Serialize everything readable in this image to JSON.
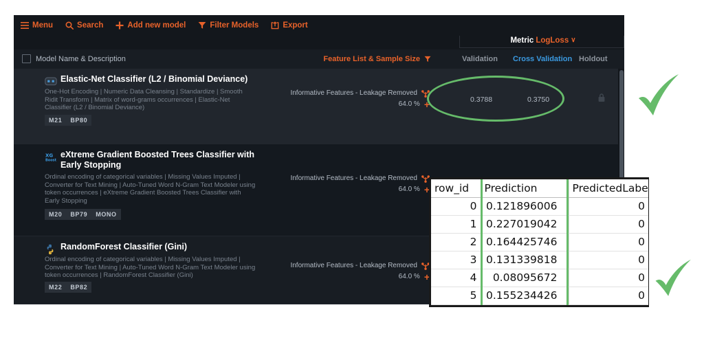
{
  "toolbar": {
    "items": [
      {
        "label": "Menu",
        "icon": "hamburger-icon"
      },
      {
        "label": "Search",
        "icon": "magnifier-icon"
      },
      {
        "label": "Add new model",
        "icon": "plus-icon"
      },
      {
        "label": "Filter Models",
        "icon": "funnel-icon"
      },
      {
        "label": "Export",
        "icon": "export-icon"
      }
    ],
    "metric_label": "Metric",
    "metric_value": "LogLoss",
    "metric_caret": "∨"
  },
  "columns": {
    "model": "Model Name & Description",
    "feature": "Feature List & Sample Size",
    "feature_icon": "funnel-icon",
    "validation": "Validation",
    "cross_validation": "Cross Validation",
    "holdout": "Holdout"
  },
  "rows": [
    {
      "icon": "robot-icon",
      "title": "Elastic-Net Classifier (L2 / Binomial Deviance)",
      "description": "One-Hot Encoding | Numeric Data Cleansing | Standardize | Smooth Ridit Transform | Matrix of word-grams occurrences | Elastic-Net Classifier (L2 / Binomial Deviance)",
      "tags": [
        "M21",
        "BP80"
      ],
      "feature_list": "Informative Features - Leakage Removed",
      "sample_size": "64.0 %",
      "validation": "0.3788",
      "cross_validation": "0.3750",
      "holdout": "lock-icon"
    },
    {
      "icon": "xgboost-icon",
      "title": "eXtreme Gradient Boosted Trees Classifier with Early Stopping",
      "description": "Ordinal encoding of categorical variables | Missing Values Imputed | Converter for Text Mining | Auto-Tuned Word N-Gram Text Modeler using token occurrences | eXtreme Gradient Boosted Trees Classifier with Early Stopping",
      "tags": [
        "M20",
        "BP79",
        "MONO"
      ],
      "feature_list": "Informative Features - Leakage Removed",
      "sample_size": "64.0 %",
      "validation": "",
      "cross_validation": "",
      "holdout": ""
    },
    {
      "icon": "python-icon",
      "title": "RandomForest Classifier (Gini)",
      "description": "Ordinal encoding of categorical variables | Missing Values Imputed | Converter for Text Mining | Auto-Tuned Word N-Gram Text Modeler using token occurrences | RandomForest Classifier (Gini)",
      "tags": [
        "M22",
        "BP82"
      ],
      "feature_list": "Informative Features - Leakage Removed",
      "sample_size": "64.0 %",
      "validation": "",
      "cross_validation": "",
      "holdout": ""
    }
  ],
  "predictions_table": {
    "headers": [
      "row_id",
      "Prediction",
      "PredictedLabel"
    ],
    "highlighted_column": "Prediction",
    "rows": [
      {
        "row_id": "0",
        "prediction": "0.121896006",
        "predicted_label": "0"
      },
      {
        "row_id": "1",
        "prediction": "0.227019042",
        "predicted_label": "0"
      },
      {
        "row_id": "2",
        "prediction": "0.164425746",
        "predicted_label": "0"
      },
      {
        "row_id": "3",
        "prediction": "0.131339818",
        "predicted_label": "0"
      },
      {
        "row_id": "4",
        "prediction": "0.08095672",
        "predicted_label": "0"
      },
      {
        "row_id": "5",
        "prediction": "0.155234426",
        "predicted_label": "0"
      }
    ]
  },
  "annotations": {
    "ellipse_target": "cross-validation-and-validation-scores",
    "checkmark_glyph": "✔",
    "checkmark_color": "#66bb6a",
    "highlight_color": "#66bb6a"
  },
  "theme": {
    "accent": "#e8622a",
    "link": "#3b9ae1",
    "panel_bg": "#13171c",
    "row_selected_bg": "#21262d"
  }
}
